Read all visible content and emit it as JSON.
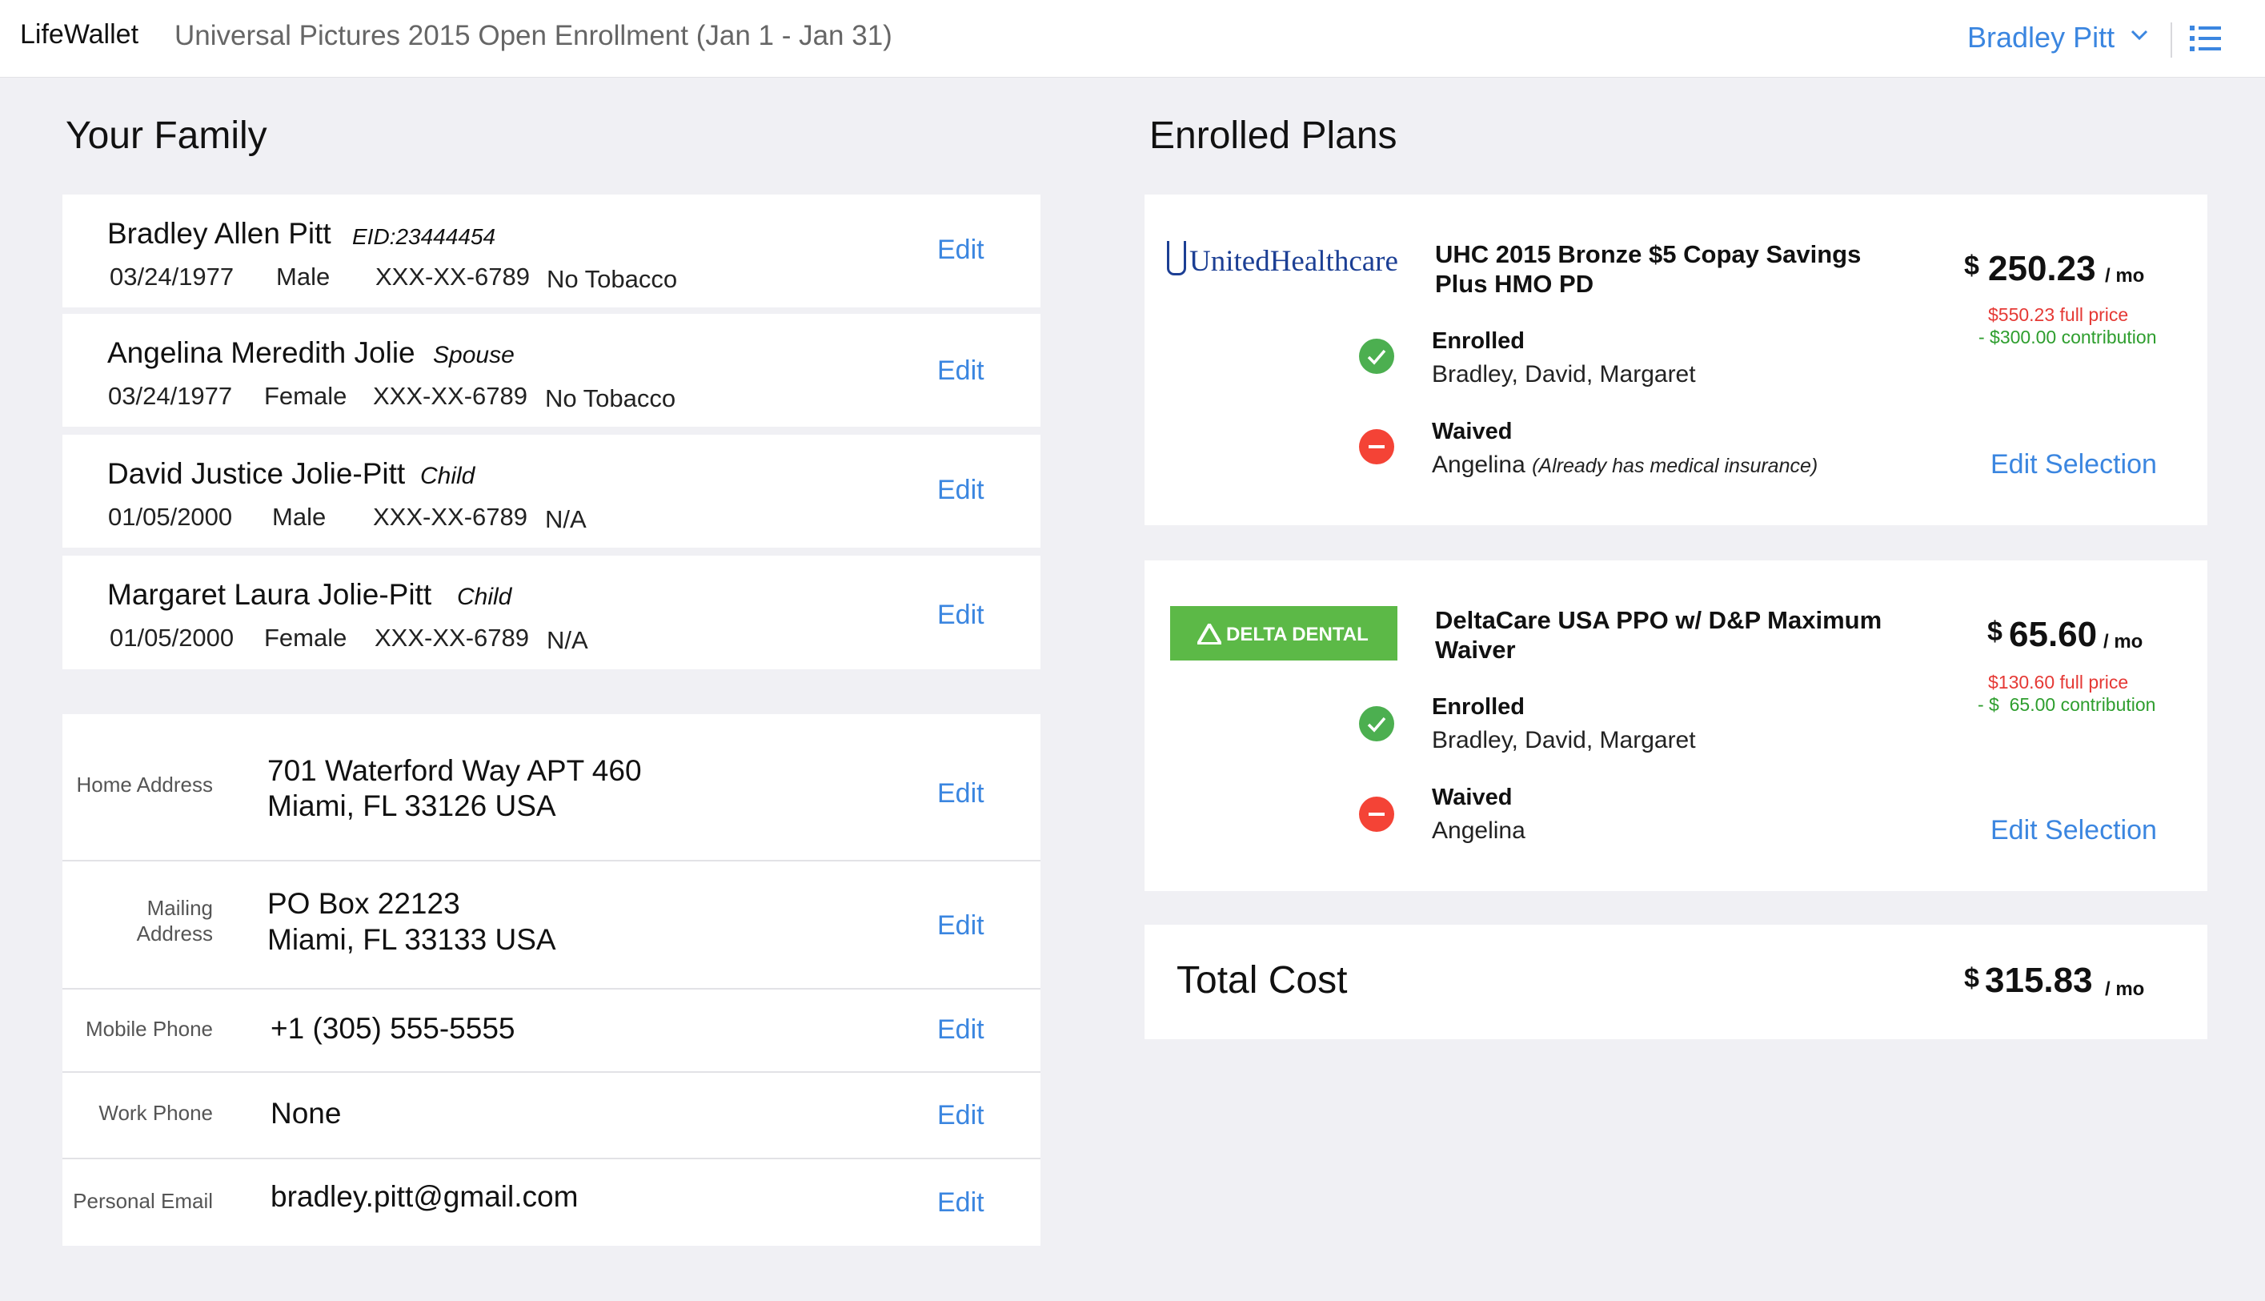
{
  "header": {
    "brand": "LifeWallet",
    "enrollment_title": "Universal Pictures 2015 Open Enrollment (Jan 1 - Jan 31)",
    "user_name": "Bradley Pitt",
    "accent_color": "#3b86e0"
  },
  "family": {
    "title": "Your Family",
    "edit_label": "Edit",
    "members": [
      {
        "name": "Bradley Allen Pitt",
        "role": "EID:23444454",
        "dob": "03/24/1977",
        "gender": "Male",
        "ssn": "XXX-XX-6789",
        "tobacco": "No Tobacco"
      },
      {
        "name": "Angelina Meredith Jolie",
        "role": "Spouse",
        "dob": "03/24/1977",
        "gender": "Female",
        "ssn": "XXX-XX-6789",
        "tobacco": "No Tobacco"
      },
      {
        "name": "David Justice Jolie-Pitt",
        "role": "Child",
        "dob": "01/05/2000",
        "gender": "Male",
        "ssn": "XXX-XX-6789",
        "tobacco": "N/A"
      },
      {
        "name": "Margaret Laura Jolie-Pitt",
        "role": "Child",
        "dob": "01/05/2000",
        "gender": "Female",
        "ssn": "XXX-XX-6789",
        "tobacco": "N/A"
      }
    ]
  },
  "contact": {
    "home_address": {
      "label": "Home Address",
      "line1": "701 Waterford Way  APT 460",
      "line2": "Miami, FL 33126  USA"
    },
    "mailing_address": {
      "label_line1": "Mailing",
      "label_line2": "Address",
      "line1": "PO Box 22123",
      "line2": "Miami, FL 33133  USA"
    },
    "mobile_phone": {
      "label": "Mobile Phone",
      "value": "+1 (305) 555-5555"
    },
    "work_phone": {
      "label": "Work Phone",
      "value": "None"
    },
    "personal_email": {
      "label": "Personal Email",
      "value": "bradley.pitt@gmail.com"
    }
  },
  "plans": {
    "title": "Enrolled Plans",
    "edit_selection_label": "Edit Selection",
    "items": [
      {
        "logo_text": "UnitedHealthcare",
        "logo_color": "#1c3f94",
        "name_line1": "UHC 2015 Bronze $5 Copay Savings",
        "name_line2": "Plus HMO PD",
        "price_symbol": "$",
        "price": "250.23",
        "per": "/ mo",
        "full_price": "$550.23 full price",
        "contribution": "- $300.00 contribution",
        "enrolled_label": "Enrolled",
        "enrolled_names": "Bradley, David, Margaret",
        "waived_label": "Waived",
        "waived_names": "Angelina",
        "waived_note": "(Already has medical insurance)"
      },
      {
        "logo_text": "DELTA DENTAL",
        "logo_color": "#5cb947",
        "name_line1": "DeltaCare USA PPO w/ D&P Maximum",
        "name_line2": "Waiver",
        "price_symbol": "$",
        "price": "65.60",
        "per": "/ mo",
        "full_price": "$130.60 full price",
        "contribution": "- $  65.00 contribution",
        "enrolled_label": "Enrolled",
        "enrolled_names": "Bradley, David, Margaret",
        "waived_label": "Waived",
        "waived_names": "Angelina",
        "waived_note": ""
      }
    ]
  },
  "total": {
    "label": "Total Cost",
    "symbol": "$",
    "amount": "315.83",
    "per": "/ mo"
  },
  "status_colors": {
    "enrolled": "#4caf50",
    "waived": "#f44336"
  }
}
